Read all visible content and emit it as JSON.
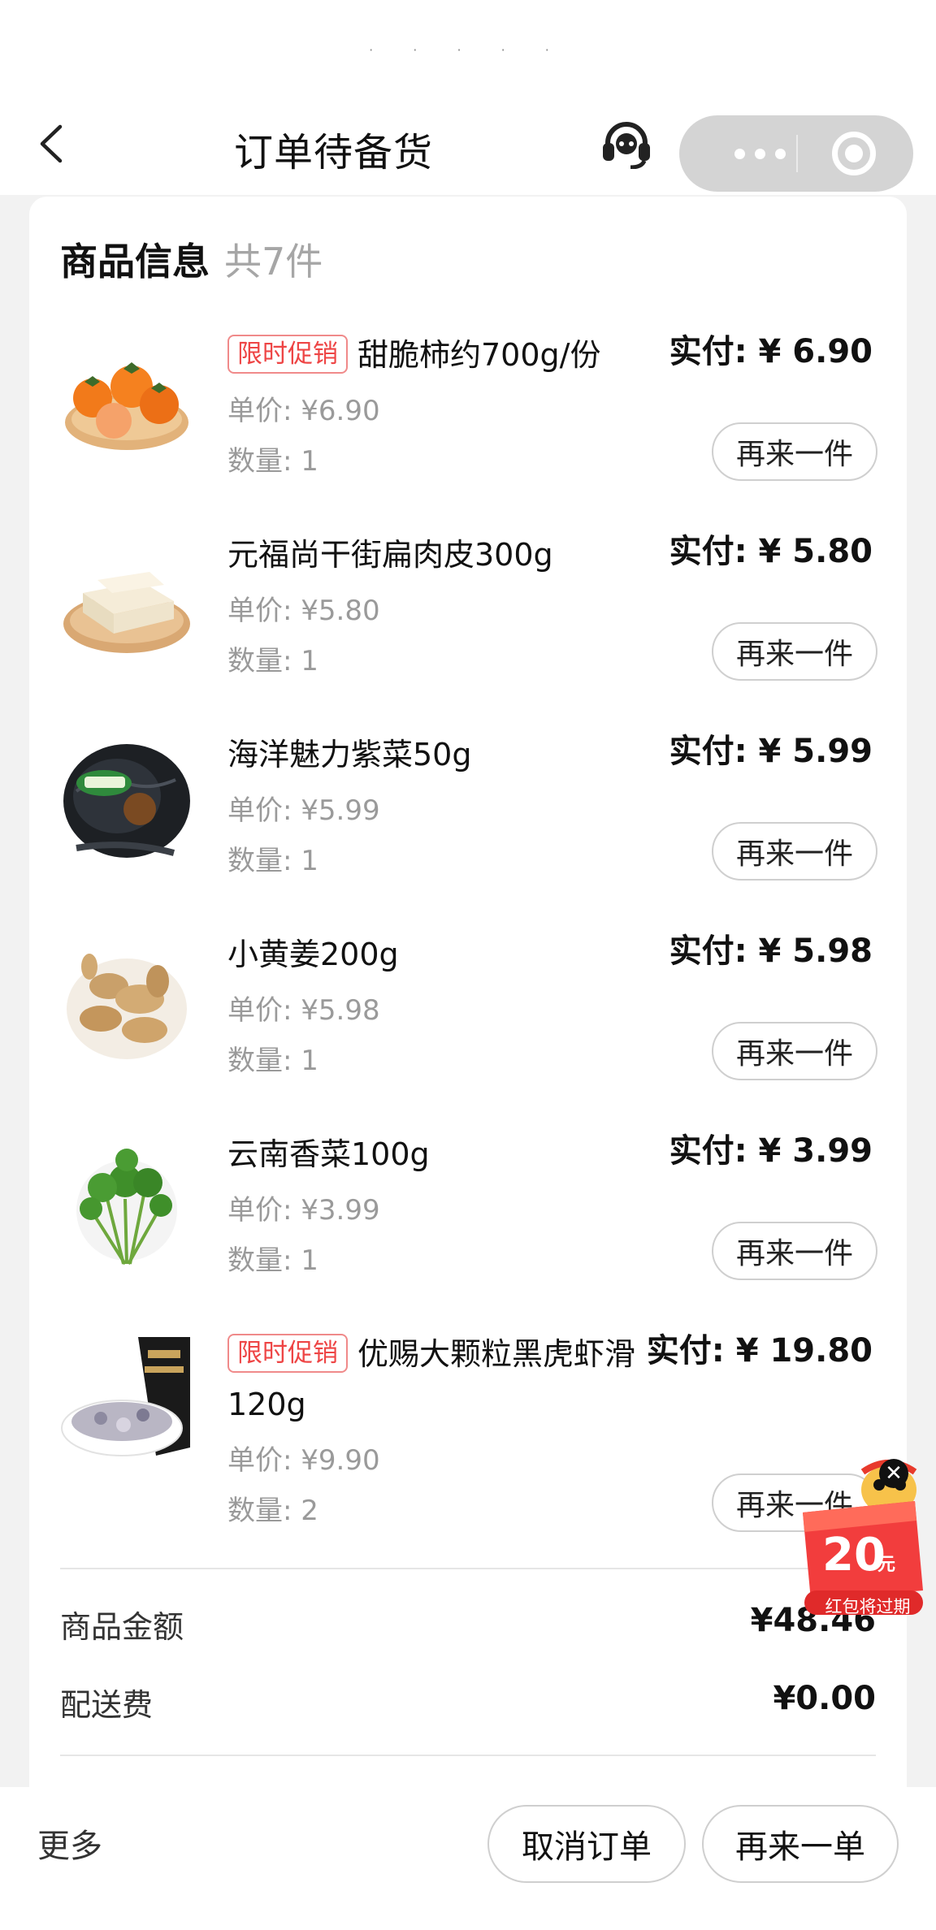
{
  "status_bar": {
    "indicator": "· · · · ·"
  },
  "header": {
    "title": "订单待备货",
    "back_icon": "chevron-left-icon",
    "service_icon": "headset-icon",
    "capsule_more_icon": "more-dots-icon",
    "capsule_close_icon": "target-icon"
  },
  "order_card": {
    "title": "商品信息",
    "count": "共7件",
    "items": [
      {
        "promo": "限时促销",
        "name": "甜脆柿约700g/份",
        "paid": "实付: ¥ 6.90",
        "unit_price": "单价: ¥6.90",
        "quantity": "数量: 1",
        "again_label": "再来一件",
        "image": "persimmon"
      },
      {
        "promo": "",
        "name": "元福尚干街扁肉皮300g",
        "paid": "实付: ¥ 5.80",
        "unit_price": "单价: ¥5.80",
        "quantity": "数量: 1",
        "again_label": "再来一件",
        "image": "wonton-wrappers"
      },
      {
        "promo": "",
        "name": "海洋魅力紫菜50g",
        "paid": "实付: ¥ 5.99",
        "unit_price": "单价: ¥5.99",
        "quantity": "数量: 1",
        "again_label": "再来一件",
        "image": "seaweed"
      },
      {
        "promo": "",
        "name": "小黄姜200g",
        "paid": "实付: ¥ 5.98",
        "unit_price": "单价: ¥5.98",
        "quantity": "数量: 1",
        "again_label": "再来一件",
        "image": "ginger"
      },
      {
        "promo": "",
        "name": "云南香菜100g",
        "paid": "实付: ¥ 3.99",
        "unit_price": "单价: ¥3.99",
        "quantity": "数量: 1",
        "again_label": "再来一件",
        "image": "cilantro"
      },
      {
        "promo": "限时促销",
        "name": "优赐大颗粒黑虎虾滑120g",
        "paid": "实付: ¥ 19.80",
        "unit_price": "单价: ¥9.90",
        "quantity": "数量: 2",
        "again_label": "再来一件",
        "image": "shrimp-paste"
      }
    ],
    "summary": {
      "goods_amount_label": "商品金额",
      "goods_amount": "¥48.46",
      "delivery_fee_label": "配送费",
      "delivery_fee": "¥0.00"
    }
  },
  "coupon": {
    "amount": "20",
    "unit": "元",
    "caption": "红包将过期",
    "close": "✕"
  },
  "bottom_bar": {
    "more": "更多",
    "cancel": "取消订单",
    "reorder": "再来一单"
  },
  "colors": {
    "promo": "#ee4545",
    "coupon": "#f23d3d",
    "capsule": "#d4d4d4"
  }
}
